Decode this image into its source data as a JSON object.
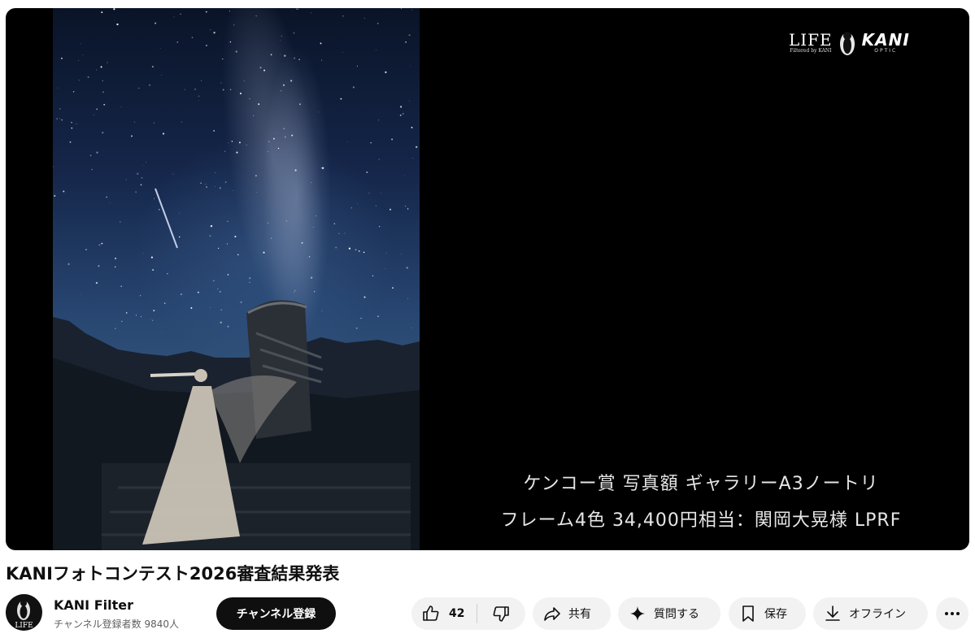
{
  "player": {
    "logo_life": "LIFE",
    "logo_life_sub": "Filtered by KANI",
    "logo_kani": "KANI",
    "logo_kani_sub": "OPTIC",
    "caption_line1": "ケンコー賞 写真額 ギャラリーA3ノートリ",
    "caption_line2": "フレーム4色 34,400円相当：関岡大晃様 LPRF"
  },
  "video": {
    "title": "KANIフォトコンテスト2026審査結果発表"
  },
  "channel": {
    "avatar_text": "LIFE",
    "name": "KANI Filter",
    "subscribers": "チャンネル登録者数 9840人",
    "subscribe_label": "チャンネル登録"
  },
  "actions": {
    "like_count": "42",
    "share_label": "共有",
    "ask_label": "質問する",
    "save_label": "保存",
    "offline_label": "オフライン"
  },
  "icons": [
    "like-icon",
    "dislike-icon",
    "share-icon",
    "sparkle-icon",
    "bookmark-icon",
    "download-icon",
    "more-icon"
  ]
}
